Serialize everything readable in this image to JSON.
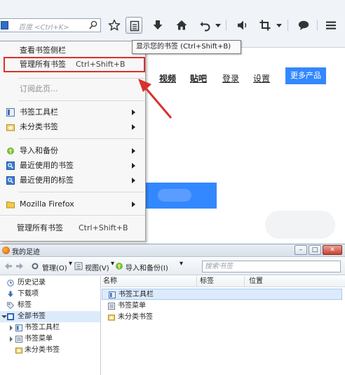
{
  "toolbar": {
    "search_placeholder": "百度 <Ctrl+K>",
    "buttons": [
      "bookmark-star",
      "show-bookmarks",
      "downloads",
      "home",
      "back",
      "history-dropdown",
      "volume",
      "crop",
      "crop-dropdown",
      "chat",
      "menu"
    ],
    "tooltip": "显示您的书签 (Ctrl+Shift+B)"
  },
  "webpage": {
    "nav_links": [
      "视频",
      "贴吧",
      "登录",
      "设置"
    ],
    "more_products": "更多产品",
    "accent": "#3388ff"
  },
  "menu": {
    "items": [
      {
        "label": "查看书签侧栏"
      },
      {
        "label": "管理所有书签",
        "shortcut": "Ctrl+Shift+B",
        "highlighted": true
      },
      {
        "label": "订阅此页...",
        "disabled": true
      },
      {
        "label": "书签工具栏",
        "submenu": true
      },
      {
        "label": "未分类书签",
        "submenu": true
      },
      {
        "label": "导入和备份",
        "submenu": true
      },
      {
        "label": "最近使用的书签",
        "submenu": true
      },
      {
        "label": "最近使用的标签",
        "submenu": true
      },
      {
        "label": "Mozilla Firefox",
        "submenu": true
      },
      {
        "label": "管理所有书签",
        "shortcut": "Ctrl+Shift+B"
      }
    ],
    "highlight_color": "#d9322b"
  },
  "library": {
    "title": "我的足迹",
    "toolbar": {
      "manage": "管理(O)",
      "views": "视图(V)",
      "import_backup": "导入和备份(I)",
      "search_placeholder": "搜索书签"
    },
    "tree": [
      {
        "label": "历史记录"
      },
      {
        "label": "下载项"
      },
      {
        "label": "标签"
      },
      {
        "label": "全部书签",
        "expanded": true,
        "selected": true
      },
      {
        "label": "书签工具栏"
      },
      {
        "label": "书签菜单"
      },
      {
        "label": "未分类书签"
      }
    ],
    "columns": [
      "名称",
      "标签",
      "位置"
    ],
    "rows": [
      {
        "name": "书签工具栏",
        "selected": true
      },
      {
        "name": "书签菜单"
      },
      {
        "name": "未分类书签"
      }
    ]
  }
}
